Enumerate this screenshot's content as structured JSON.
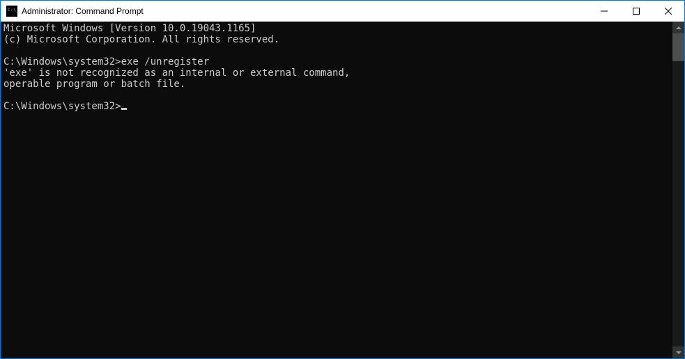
{
  "titlebar": {
    "title": "Administrator: Command Prompt",
    "icon": "cmd-icon"
  },
  "window_controls": {
    "minimize": "minimize",
    "maximize": "maximize",
    "close": "close"
  },
  "console": {
    "line1": "Microsoft Windows [Version 10.0.19043.1165]",
    "line2": "(c) Microsoft Corporation. All rights reserved.",
    "blank1": "",
    "prompt1_path": "C:\\Windows\\system32>",
    "prompt1_command": "exe /unregister",
    "error1": "'exe' is not recognized as an internal or external command,",
    "error2": "operable program or batch file.",
    "blank2": "",
    "prompt2_path": "C:\\Windows\\system32>"
  }
}
